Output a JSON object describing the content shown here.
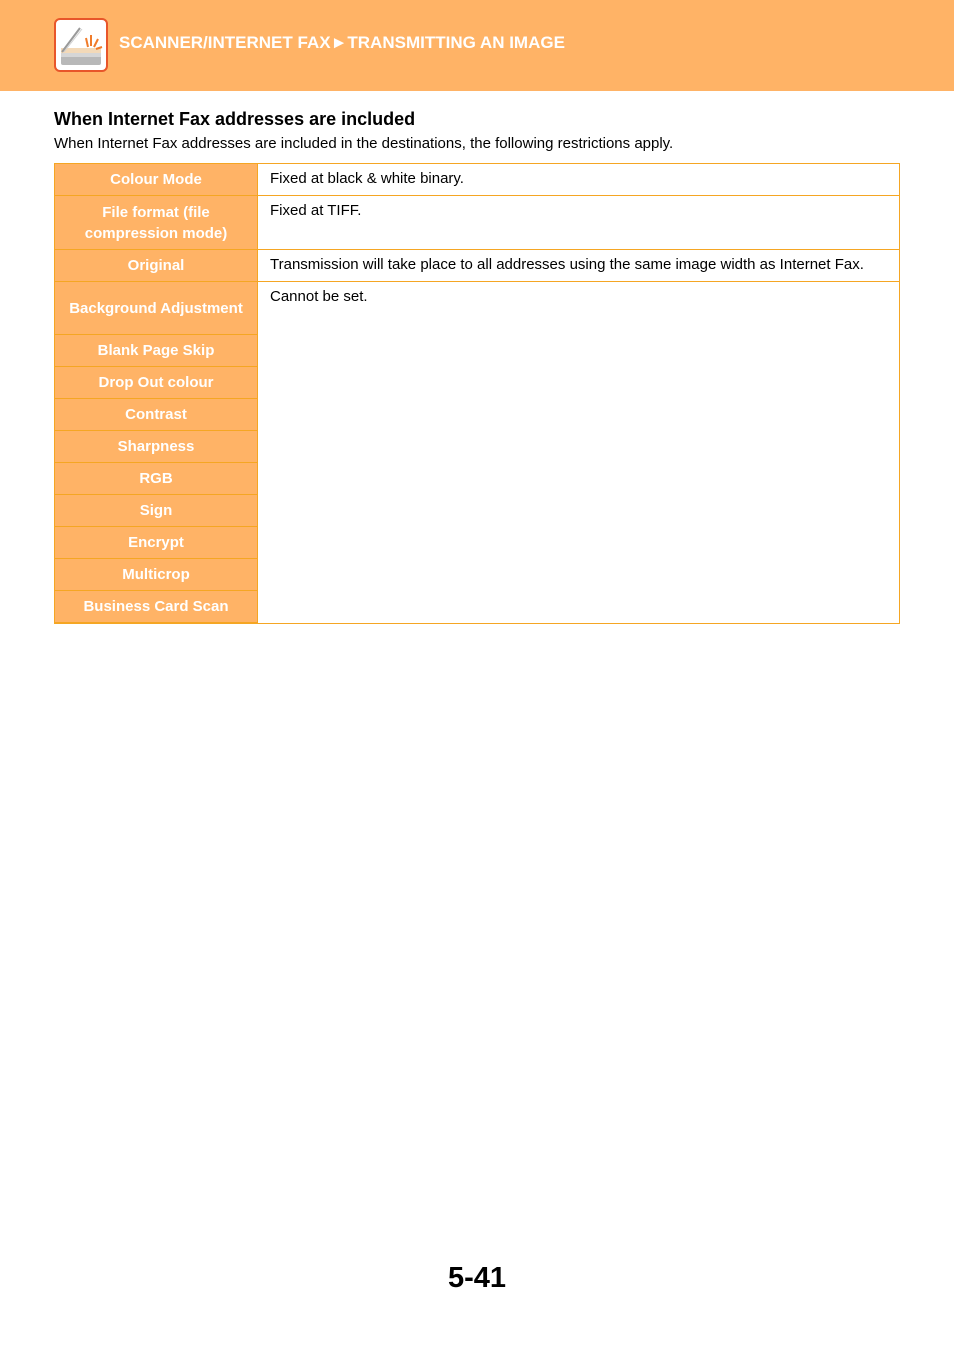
{
  "header": {
    "icon": "scanner-icon",
    "title": "SCANNER/INTERNET FAX►TRANSMITTING AN IMAGE",
    "band_color": "#FFB366"
  },
  "section": {
    "heading": "When Internet Fax addresses are included",
    "intro": "When Internet Fax addresses are included in the destinations, the following restrictions apply."
  },
  "table": {
    "accent_color": "#F5A623",
    "rows": [
      {
        "label": "Colour Mode",
        "value": "Fixed at black & white binary."
      },
      {
        "label": "File format (file compression mode)",
        "value": "Fixed at TIFF."
      },
      {
        "label": "Original",
        "value": "Transmission will take place to all addresses using the same image width as Internet Fax."
      },
      {
        "label": "Background Adjustment",
        "value": "Cannot be set."
      },
      {
        "label": "Blank Page Skip"
      },
      {
        "label": "Drop Out colour"
      },
      {
        "label": "Contrast"
      },
      {
        "label": "Sharpness"
      },
      {
        "label": "RGB"
      },
      {
        "label": "Sign"
      },
      {
        "label": "Encrypt"
      },
      {
        "label": "Multicrop"
      },
      {
        "label": "Business Card Scan"
      }
    ]
  },
  "footer": {
    "page_number": "5-41"
  }
}
